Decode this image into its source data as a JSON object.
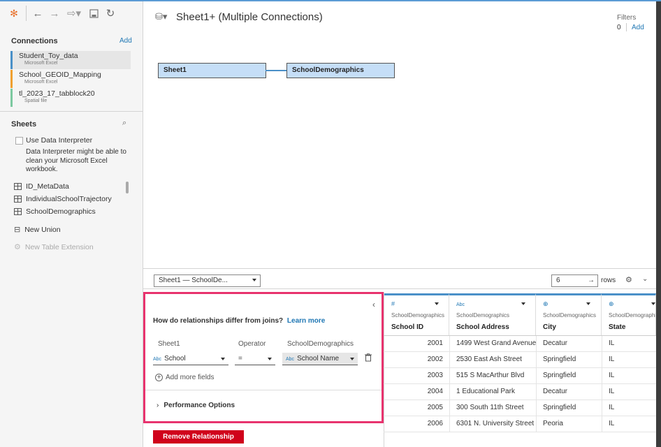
{
  "app": {
    "accent_color": "#4a90c8",
    "highlight_color": "#e8336e"
  },
  "toolbar": {
    "icons": [
      "tableau-logo-icon",
      "back-icon",
      "forward-icon",
      "redo-icon",
      "save-icon",
      "refresh-icon"
    ]
  },
  "connections": {
    "title": "Connections",
    "add_label": "Add",
    "items": [
      {
        "name": "Student_Toy_data",
        "type": "Microsoft Excel",
        "color": "#4a90c8"
      },
      {
        "name": "School_GEOID_Mapping",
        "type": "Microsoft Excel",
        "color": "#f0a030"
      },
      {
        "name": "tl_2023_17_tabblock20",
        "type": "Spatial file",
        "color": "#7cc9a0"
      }
    ]
  },
  "sheets": {
    "title": "Sheets",
    "interpreter_label": "Use Data Interpreter",
    "interpreter_desc": "Data Interpreter might be able to clean your Microsoft Excel workbook.",
    "items": [
      "ID_MetaData",
      "IndividualSchoolTrajectory",
      "SchoolDemographics"
    ],
    "new_union": "New Union",
    "new_table_ext": "New Table Extension"
  },
  "canvas": {
    "title": "Sheet1+ (Multiple Connections)",
    "filters_label": "Filters",
    "filters_count": "0",
    "filters_add": "Add",
    "nodes": [
      "Sheet1",
      "SchoolDemographics"
    ]
  },
  "grid_controls": {
    "table_select": "Sheet1 — SchoolDe...",
    "rows_value": "6",
    "rows_label": "rows"
  },
  "relationship": {
    "question": "How do relationships differ from joins?",
    "learn_more": "Learn more",
    "left_header": "Sheet1",
    "op_header": "Operator",
    "right_header": "SchoolDemographics",
    "left_field": "School",
    "operator": "=",
    "right_field": "School Name",
    "type_abc": "Abc",
    "add_more": "Add more fields",
    "perf_options": "Performance Options",
    "remove_button": "Remove Relationship"
  },
  "data_grid": {
    "columns": [
      {
        "type_icon": "#",
        "source": "SchoolDemographics",
        "name": "School ID"
      },
      {
        "type_icon": "Abc",
        "source": "SchoolDemographics",
        "name": "School Address"
      },
      {
        "type_icon": "⊕",
        "source": "SchoolDemographics",
        "name": "City"
      },
      {
        "type_icon": "⊕",
        "source": "SchoolDemographics",
        "name": "State"
      }
    ],
    "rows": [
      [
        "2001",
        "1499 West Grand Avenue",
        "Decatur",
        "IL"
      ],
      [
        "2002",
        "2530 East Ash Street",
        "Springfield",
        "IL"
      ],
      [
        "2003",
        "515 S MacArthur Blvd",
        "Springfield",
        "IL"
      ],
      [
        "2004",
        "1 Educational Park",
        "Decatur",
        "IL"
      ],
      [
        "2005",
        "300 South 11th Street",
        "Springfield",
        "IL"
      ],
      [
        "2006",
        "6301 N. University Street",
        "Peoria",
        "IL"
      ]
    ]
  }
}
